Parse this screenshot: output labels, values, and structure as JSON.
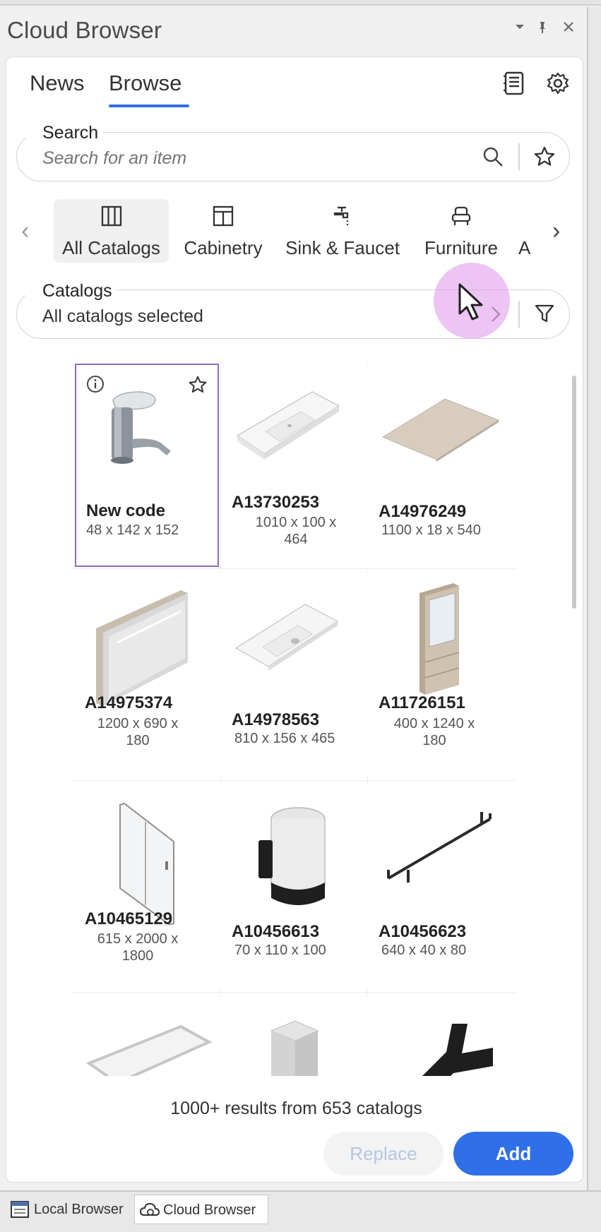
{
  "window": {
    "title": "Cloud Browser",
    "controls": [
      "dropdown-icon",
      "pin-icon",
      "close-icon"
    ]
  },
  "header": {
    "tabs": [
      {
        "label": "News",
        "active": false
      },
      {
        "label": "Browse",
        "active": true
      }
    ],
    "icons": [
      "catalog-book-icon",
      "gear-icon"
    ]
  },
  "search": {
    "label": "Search",
    "placeholder": "Search for an item",
    "icons": [
      "search-icon",
      "star-icon"
    ]
  },
  "categories": [
    {
      "label": "All Catalogs",
      "icon": "catalog-columns-icon",
      "selected": true
    },
    {
      "label": "Cabinetry",
      "icon": "cabinet-icon",
      "selected": false
    },
    {
      "label": "Sink & Faucet",
      "icon": "faucet-icon",
      "selected": false
    },
    {
      "label": "Furniture",
      "icon": "armchair-icon",
      "selected": false
    },
    {
      "label": "A",
      "icon": "",
      "selected": false
    }
  ],
  "catalogs": {
    "label": "Catalogs",
    "value": "All catalogs selected",
    "icons": [
      "chevron-right-icon",
      "filter-icon"
    ]
  },
  "items": [
    {
      "code": "New code",
      "dims_line1": "48 x  142 x  152",
      "dims_line2": "",
      "thumb": "faucet",
      "selected": true
    },
    {
      "code": "A13730253",
      "dims_line1": "1010 x  100 x",
      "dims_line2": "464",
      "thumb": "basin-wide",
      "selected": false
    },
    {
      "code": "A14976249",
      "dims_line1": "1100 x  18 x  540",
      "dims_line2": "",
      "thumb": "panel-flat",
      "selected": false
    },
    {
      "code": "A14975374",
      "dims_line1": "1200 x  690 x",
      "dims_line2": "180",
      "thumb": "mirror-cabinet",
      "selected": false
    },
    {
      "code": "A14978563",
      "dims_line1": "810 x  156 x  465",
      "dims_line2": "",
      "thumb": "basin-slab",
      "selected": false
    },
    {
      "code": "A11726151",
      "dims_line1": "400 x  1240 x",
      "dims_line2": "180",
      "thumb": "tall-cabinet",
      "selected": false
    },
    {
      "code": "A10465129",
      "dims_line1": "615 x  2000 x",
      "dims_line2": "1800",
      "thumb": "shower-panel",
      "selected": false
    },
    {
      "code": "A10456613",
      "dims_line1": "70 x  110 x  100",
      "dims_line2": "",
      "thumb": "cup-holder",
      "selected": false
    },
    {
      "code": "A10456623",
      "dims_line1": "640 x  40 x  80",
      "dims_line2": "",
      "thumb": "towel-rail",
      "selected": false
    },
    {
      "code": "",
      "dims_line1": "",
      "dims_line2": "",
      "thumb": "bathtub-partial",
      "selected": false
    },
    {
      "code": "",
      "dims_line1": "",
      "dims_line2": "",
      "thumb": "pillar-partial",
      "selected": false
    },
    {
      "code": "",
      "dims_line1": "",
      "dims_line2": "",
      "thumb": "hook-partial",
      "selected": false
    }
  ],
  "results_text": "1000+ results from 653 catalogs",
  "actions": {
    "replace": "Replace",
    "add": "Add"
  },
  "bottom_tabs": [
    {
      "label": "Local Browser",
      "active": false
    },
    {
      "label": "Cloud Browser",
      "active": true
    }
  ],
  "colors": {
    "accent": "#2f6fe8",
    "selection_border": "#8a6fc0",
    "tab_underline": "#2f6fe0"
  }
}
